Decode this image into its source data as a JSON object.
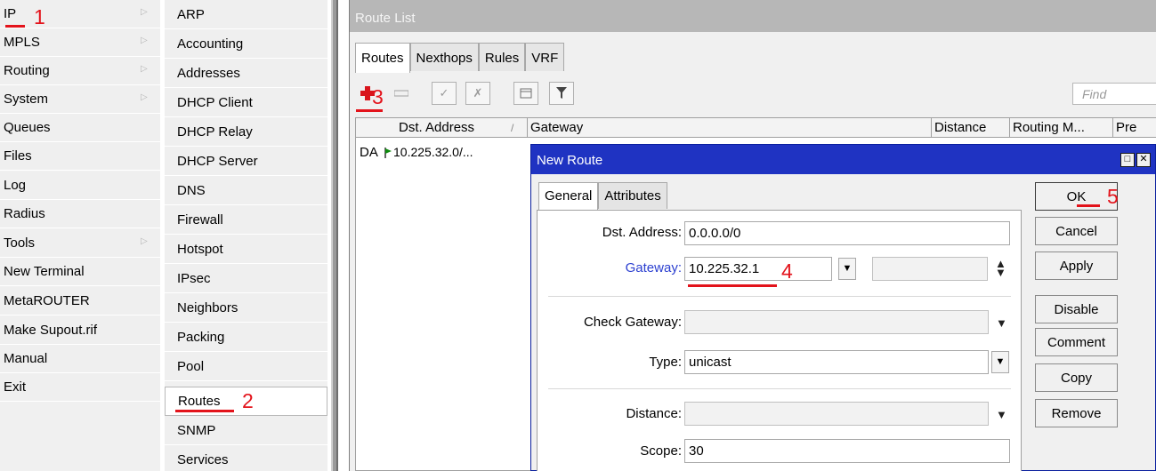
{
  "main_menu": {
    "items": [
      {
        "label": "IP",
        "submenu": true
      },
      {
        "label": "MPLS",
        "submenu": true
      },
      {
        "label": "Routing",
        "submenu": true
      },
      {
        "label": "System",
        "submenu": true
      },
      {
        "label": "Queues",
        "submenu": false
      },
      {
        "label": "Files",
        "submenu": false
      },
      {
        "label": "Log",
        "submenu": false
      },
      {
        "label": "Radius",
        "submenu": false
      },
      {
        "label": "Tools",
        "submenu": true
      },
      {
        "label": "New Terminal",
        "submenu": false
      },
      {
        "label": "MetaROUTER",
        "submenu": false
      },
      {
        "label": "Make Supout.rif",
        "submenu": false
      },
      {
        "label": "Manual",
        "submenu": false
      },
      {
        "label": "Exit",
        "submenu": false
      }
    ],
    "submenu_arrow": "▷"
  },
  "ip_submenu": {
    "items": [
      "ARP",
      "Accounting",
      "Addresses",
      "DHCP Client",
      "DHCP Relay",
      "DHCP Server",
      "DNS",
      "Firewall",
      "Hotspot",
      "IPsec",
      "Neighbors",
      "Packing",
      "Pool",
      "Routes",
      "SNMP",
      "Services"
    ],
    "selected": "Routes"
  },
  "route_list": {
    "title": "Route List",
    "tabs": [
      "Routes",
      "Nexthops",
      "Rules",
      "VRF"
    ],
    "active_tab": "Routes",
    "toolbar": {
      "add_icon": "plus-icon",
      "remove_icon": "minus-icon",
      "enable_icon": "check-icon",
      "disable_icon": "cross-icon",
      "comment_icon": "note-icon",
      "filter_icon": "filter-icon",
      "find_placeholder": "Find"
    },
    "columns": [
      "Dst. Address",
      "Gateway",
      "Distance",
      "Routing M...",
      "Pre"
    ],
    "sort_indicator": "/",
    "rows": [
      {
        "flags": "DA",
        "dst_address": "10.225.32.0/..."
      }
    ]
  },
  "new_route_dialog": {
    "title": "New Route",
    "title_buttons": [
      "□",
      "✕"
    ],
    "tabs": [
      "General",
      "Attributes"
    ],
    "active_tab": "General",
    "fields": {
      "dst_address": {
        "label": "Dst. Address:",
        "value": "0.0.0.0/0"
      },
      "gateway": {
        "label": "Gateway:",
        "value": "10.225.32.1"
      },
      "check_gateway": {
        "label": "Check Gateway:",
        "value": ""
      },
      "type": {
        "label": "Type:",
        "value": "unicast"
      },
      "distance": {
        "label": "Distance:",
        "value": ""
      },
      "scope": {
        "label": "Scope:",
        "value": "30"
      }
    },
    "buttons": [
      "OK",
      "Cancel",
      "Apply",
      "Disable",
      "Comment",
      "Copy",
      "Remove"
    ]
  },
  "annotations": [
    "1",
    "2",
    "3",
    "4",
    "5"
  ],
  "colors": {
    "dialog_title": "#1f33c2",
    "annotation": "#e3131b",
    "gateway_label": "#2b3fd0",
    "route_flag": "#0d8a0d"
  }
}
